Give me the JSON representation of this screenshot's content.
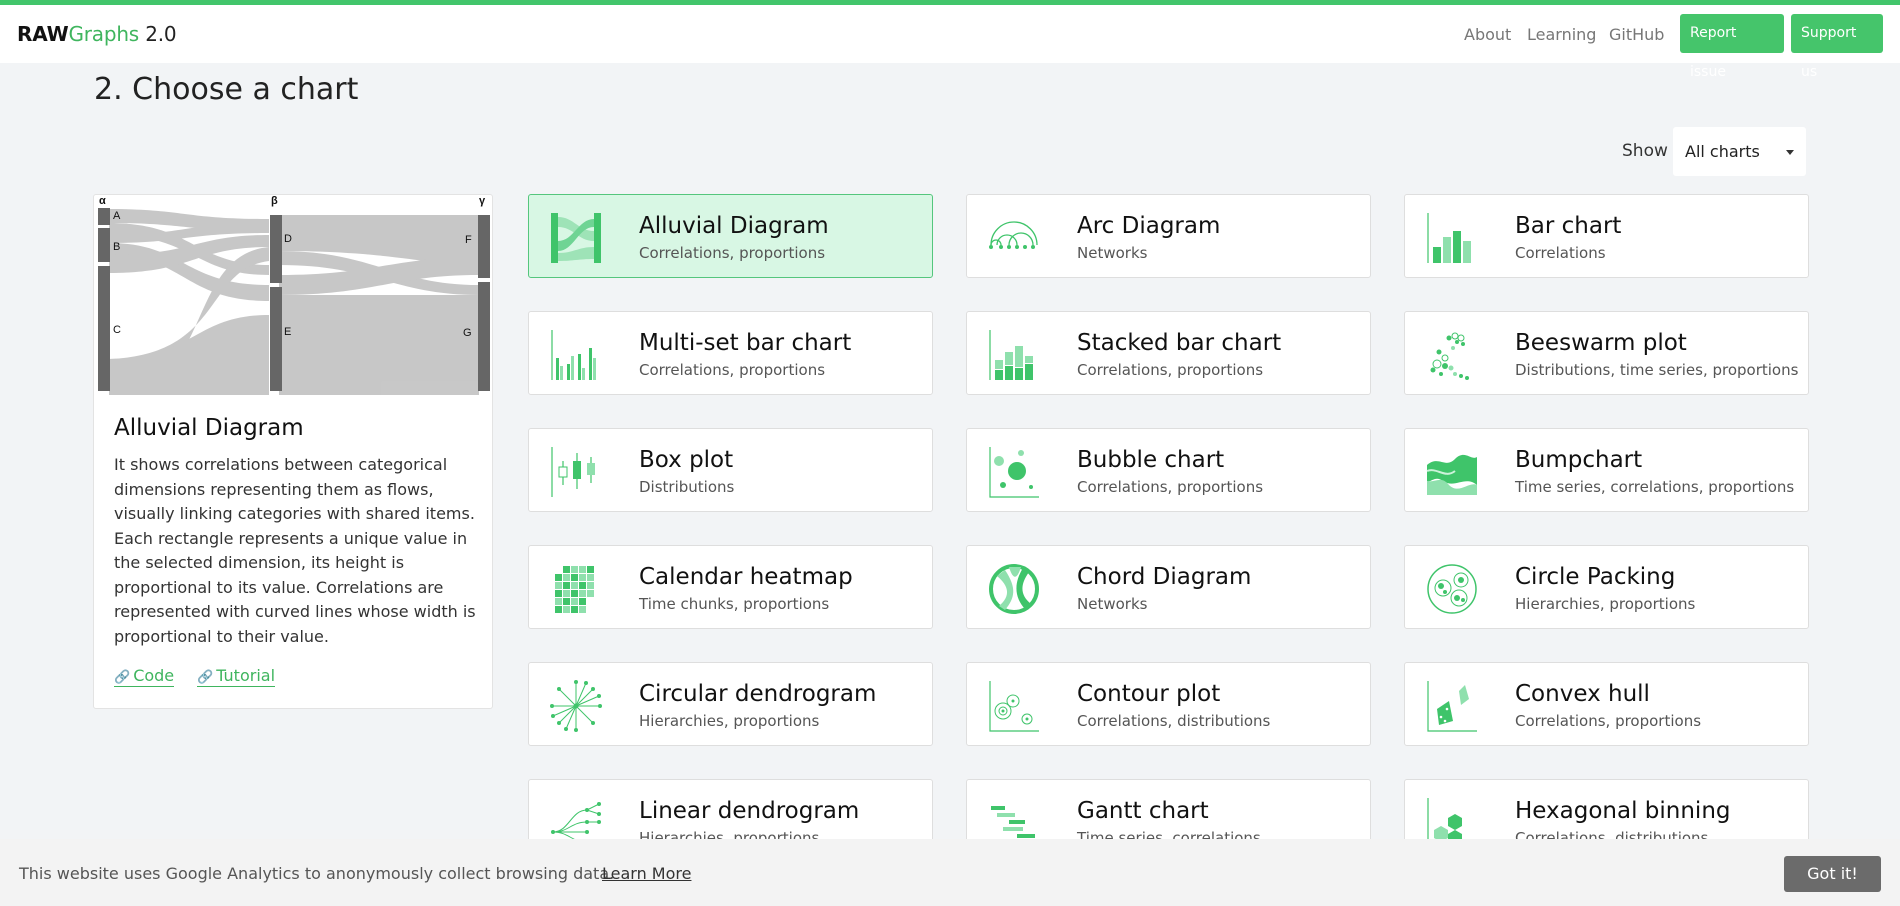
{
  "colors": {
    "accent": "#45c56b",
    "accent_dark": "#3fb55e",
    "selected_bg": "#d8f7e4"
  },
  "brand": {
    "part1": "RAW",
    "part2": "Graphs",
    "part3": " 2.0"
  },
  "nav": {
    "links": [
      "About",
      "Learning",
      "GitHub"
    ],
    "report_label": "Report issue",
    "support_label": "Support us"
  },
  "section_title": "2. Choose a chart",
  "filter": {
    "label": "Show",
    "value": "All charts"
  },
  "preview": {
    "dimension_labels": [
      "α",
      "β",
      "γ"
    ],
    "node_labels": [
      "A",
      "B",
      "C",
      "D",
      "E",
      "F",
      "G"
    ]
  },
  "selected_chart": {
    "title": "Alluvial Diagram",
    "description": "It shows correlations between categorical dimensions representing them as flows, visually linking categories with shared items. Each rectangle represents a unique value in the selected dimension, its height is proportional to its value. Correlations are represented with curved lines whose width is proportional to their value.",
    "code_label": "Code",
    "tutorial_label": "Tutorial"
  },
  "charts": [
    {
      "name": "Alluvial Diagram",
      "categories": "Correlations, proportions",
      "icon": "alluvial-icon",
      "selected": true
    },
    {
      "name": "Arc Diagram",
      "categories": "Networks",
      "icon": "arc-icon"
    },
    {
      "name": "Bar chart",
      "categories": "Correlations",
      "icon": "bar-icon"
    },
    {
      "name": "Multi-set bar chart",
      "categories": "Correlations, proportions",
      "icon": "multiset-bar-icon"
    },
    {
      "name": "Stacked bar chart",
      "categories": "Correlations, proportions",
      "icon": "stacked-bar-icon"
    },
    {
      "name": "Beeswarm plot",
      "categories": "Distributions, time series, proportions",
      "icon": "beeswarm-icon"
    },
    {
      "name": "Box plot",
      "categories": "Distributions",
      "icon": "boxplot-icon"
    },
    {
      "name": "Bubble chart",
      "categories": "Correlations, proportions",
      "icon": "bubble-icon"
    },
    {
      "name": "Bumpchart",
      "categories": "Time series, correlations, proportions",
      "icon": "bump-icon"
    },
    {
      "name": "Calendar heatmap",
      "categories": "Time chunks, proportions",
      "icon": "calendar-icon"
    },
    {
      "name": "Chord Diagram",
      "categories": "Networks",
      "icon": "chord-icon"
    },
    {
      "name": "Circle Packing",
      "categories": "Hierarchies, proportions",
      "icon": "circle-packing-icon"
    },
    {
      "name": "Circular dendrogram",
      "categories": "Hierarchies, proportions",
      "icon": "circular-dendrogram-icon"
    },
    {
      "name": "Contour plot",
      "categories": "Correlations, distributions",
      "icon": "contour-icon"
    },
    {
      "name": "Convex hull",
      "categories": "Correlations, proportions",
      "icon": "convex-hull-icon"
    },
    {
      "name": "Linear dendrogram",
      "categories": "Hierarchies, proportions",
      "icon": "linear-dendrogram-icon"
    },
    {
      "name": "Gantt chart",
      "categories": "Time series, correlations",
      "icon": "gantt-icon"
    },
    {
      "name": "Hexagonal binning",
      "categories": "Correlations, distributions",
      "icon": "hexbin-icon"
    }
  ],
  "cookie": {
    "message": "This website uses Google Analytics to anonymously collect browsing data.",
    "learn_more": "Learn More",
    "accept": "Got it!"
  }
}
